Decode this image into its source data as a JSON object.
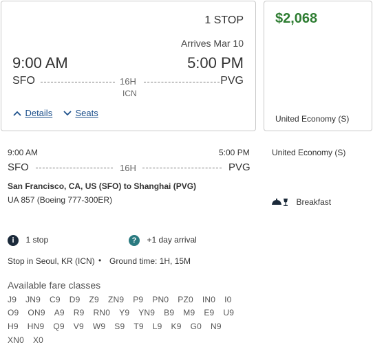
{
  "summary": {
    "stops": "1 STOP",
    "arrives": "Arrives Mar 10",
    "depart_time": "9:00 AM",
    "arrive_time": "5:00 PM",
    "origin": "SFO",
    "destination": "PVG",
    "duration": "16H",
    "via": "ICN",
    "details_link": "Details",
    "seats_link": "Seats"
  },
  "price_card": {
    "price": "$2,068",
    "fare_class": "United Economy (S)"
  },
  "detail": {
    "depart_time": "9:00 AM",
    "arrive_time": "5:00 PM",
    "origin": "SFO",
    "destination": "PVG",
    "duration": "16H",
    "cabin": "United Economy (S)",
    "route": "San Francisco, CA, US (SFO) to Shanghai (PVG)",
    "flight": "UA 857 (Boeing 777-300ER)",
    "meal": "Breakfast",
    "stops_text": "1 stop",
    "info_icon": "i",
    "help_icon": "?",
    "arrival_note": "+1 day arrival",
    "stop_location": "Stop in Seoul, KR (ICN)",
    "ground_time": "Ground time: 1H, 15M"
  },
  "fare_classes": {
    "title": "Available fare classes",
    "rows": [
      [
        "J9",
        "JN9",
        "C9",
        "D9",
        "Z9",
        "ZN9",
        "P9",
        "PN0",
        "PZ0",
        "IN0",
        "I0"
      ],
      [
        "O9",
        "ON9",
        "A9",
        "R9",
        "RN0",
        "Y9",
        "YN9",
        "B9",
        "M9",
        "E9",
        "U9"
      ],
      [
        "H9",
        "HN9",
        "Q9",
        "V9",
        "W9",
        "S9",
        "T9",
        "L9",
        "K9",
        "G0",
        "N9"
      ],
      [
        "XN0",
        "X0"
      ]
    ]
  },
  "colors": {
    "price": "#2e7d32",
    "link": "#1a4e8a",
    "info_icon": "#1b2a3a",
    "help_icon": "#2a7a80"
  }
}
